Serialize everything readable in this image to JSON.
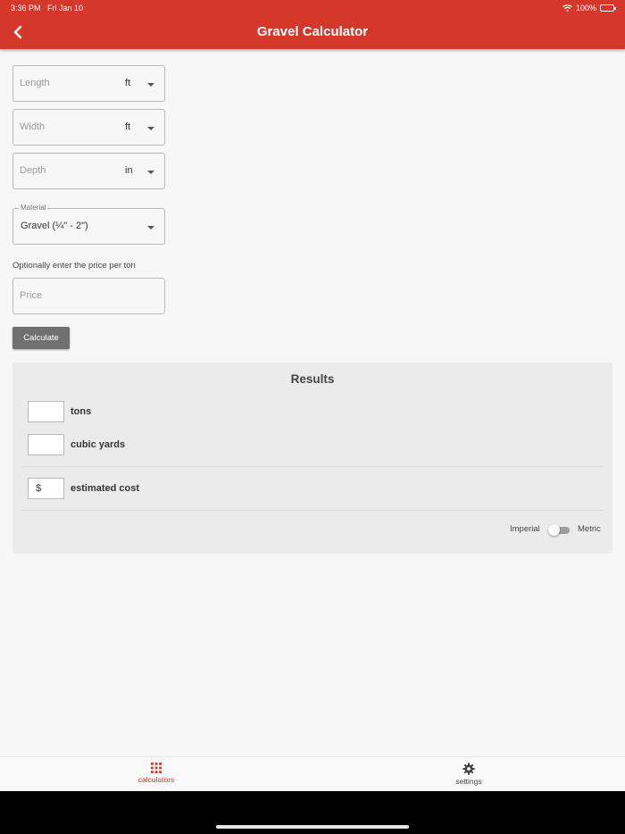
{
  "status_bar": {
    "time": "3:36 PM",
    "date": "Fri Jan 10",
    "battery": "100%"
  },
  "header": {
    "title": "Gravel Calculator"
  },
  "form": {
    "length": {
      "placeholder": "Length",
      "unit": "ft"
    },
    "width": {
      "placeholder": "Width",
      "unit": "ft"
    },
    "depth": {
      "placeholder": "Depth",
      "unit": "in"
    },
    "material": {
      "label": "Material",
      "value": "Gravel (¼\" - 2\")"
    },
    "price_hint": "Optionally enter the price per ton",
    "price": {
      "placeholder": "Price"
    },
    "calculate_label": "Calculate"
  },
  "results": {
    "title": "Results",
    "tons": {
      "value": "",
      "label": "tons"
    },
    "cubic_yards": {
      "value": "",
      "label": "cubic yards"
    },
    "cost": {
      "value": "$",
      "label": "estimated cost"
    },
    "imperial_label": "Imperial",
    "metric_label": "Metric",
    "metric_enabled": false
  },
  "bottom_nav": {
    "items": [
      {
        "label": "calculators",
        "icon": "grid-icon",
        "active": true
      },
      {
        "label": "settings",
        "icon": "gear-icon",
        "active": false
      }
    ]
  },
  "colors": {
    "accent": "#d5372b",
    "button": "#707070",
    "card": "#ebebeb"
  }
}
